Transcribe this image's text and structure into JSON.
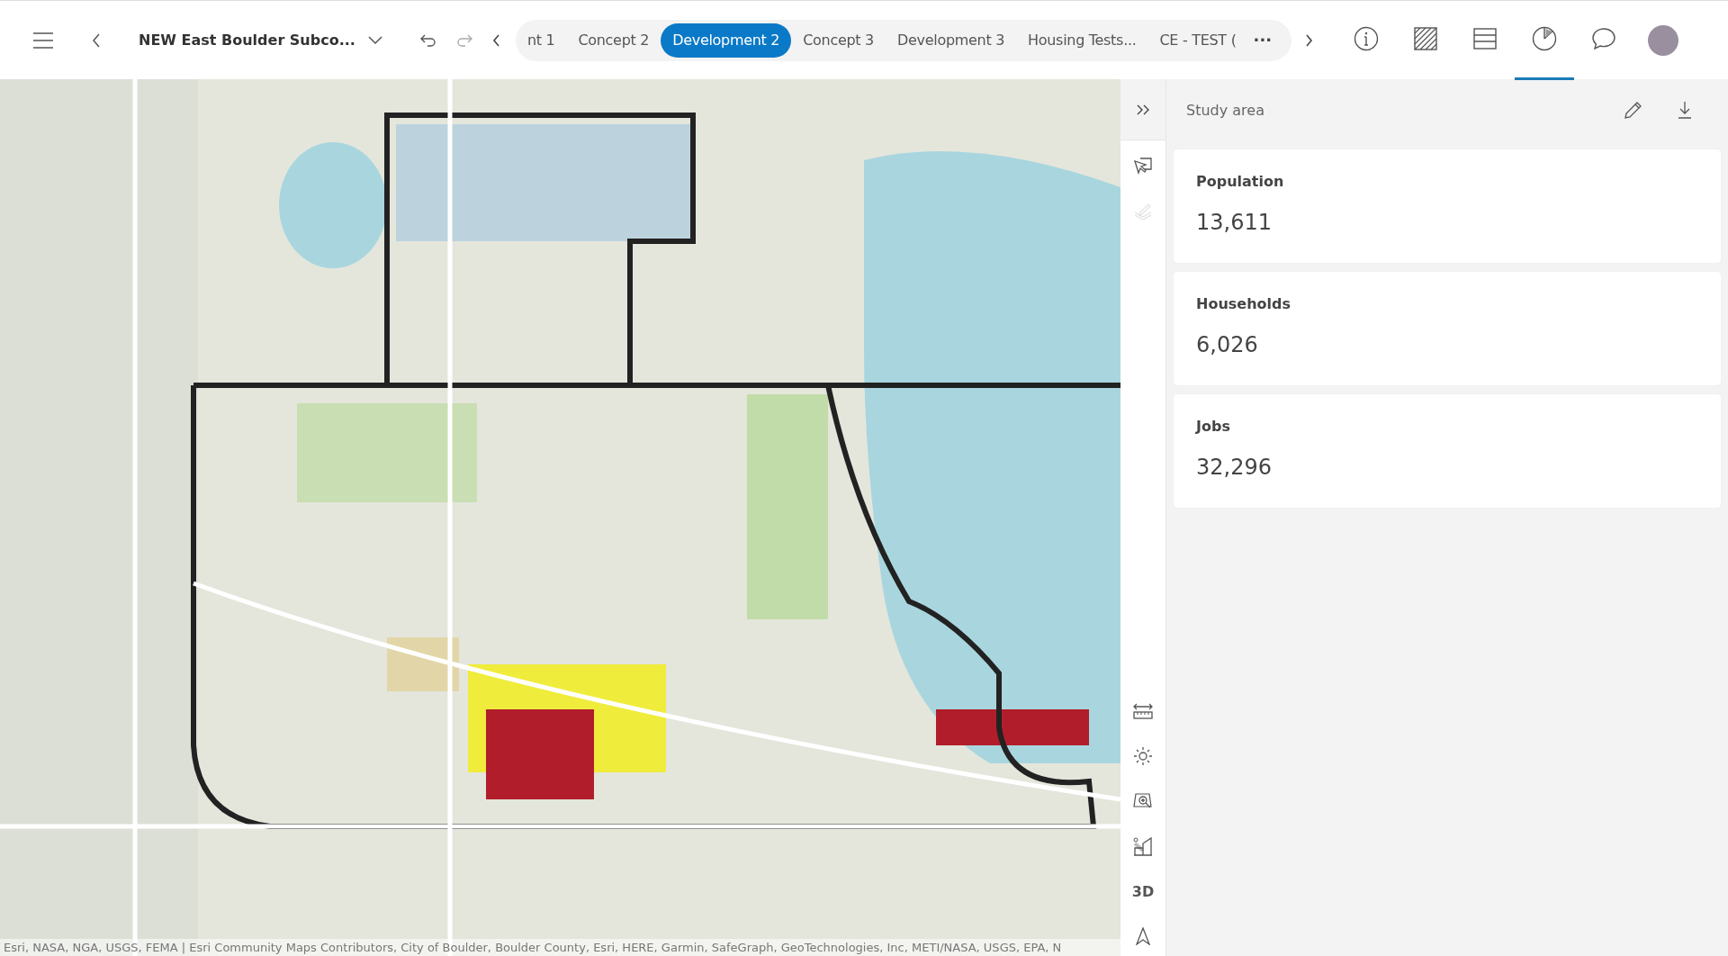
{
  "header": {
    "title": "NEW East Boulder Subco...",
    "more": "···",
    "scenarios": [
      {
        "label": "nt 1",
        "selected": false
      },
      {
        "label": "Concept 2",
        "selected": false
      },
      {
        "label": "Development 2",
        "selected": true
      },
      {
        "label": "Concept 3",
        "selected": false
      },
      {
        "label": "Development 3",
        "selected": false
      },
      {
        "label": "Housing Tests...",
        "selected": false
      },
      {
        "label": "CE - TEST (",
        "selected": false
      }
    ],
    "tools": [
      {
        "kind": "info",
        "selected": false
      },
      {
        "kind": "hatch",
        "selected": false
      },
      {
        "kind": "table",
        "selected": false
      },
      {
        "kind": "chart",
        "selected": true
      },
      {
        "kind": "comment",
        "selected": false
      }
    ]
  },
  "map": {
    "attribution": "Esri, NASA, NGA, USGS, FEMA | Esri Community Maps Contributors, City of Boulder, Boulder County, Esri, HERE, Garmin, SafeGraph, GeoTechnologies, Inc, METI/NASA, USGS, EPA, N"
  },
  "side_tools_top": [
    {
      "kind": "select",
      "disabled": false
    },
    {
      "kind": "edit",
      "disabled": true
    }
  ],
  "side_tools": [
    {
      "kind": "measure",
      "disabled": false
    },
    {
      "kind": "sun",
      "disabled": false
    },
    {
      "kind": "zoom",
      "disabled": false
    },
    {
      "kind": "shadow",
      "disabled": false
    },
    {
      "kind": "text",
      "label": "3D",
      "disabled": false
    },
    {
      "kind": "north",
      "disabled": false
    }
  ],
  "panel": {
    "title": "Study area",
    "cards": [
      {
        "label": "Population",
        "value": "13,611"
      },
      {
        "label": "Households",
        "value": "6,026"
      },
      {
        "label": "Jobs",
        "value": "32,296"
      }
    ]
  }
}
